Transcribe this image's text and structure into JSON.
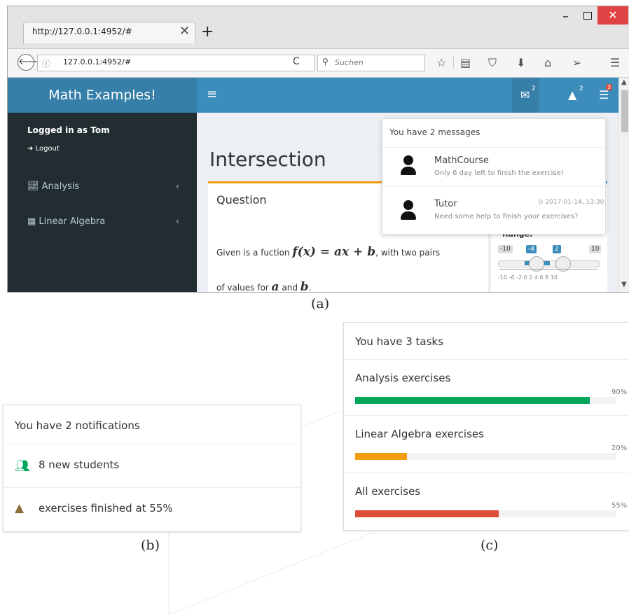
{
  "browser": {
    "tab_title": "http://127.0.0.1:4952/#",
    "tab_close": "✕",
    "new_tab": "+",
    "window_controls": {
      "minimize": "–",
      "close": "✕"
    },
    "back": "🡐",
    "info": "ⓘ",
    "url": "127.0.0.1:4952/#",
    "reload": "C",
    "search_placeholder": "Suchen",
    "toolbar_icons": [
      "star-icon",
      "reader-icon",
      "pocket-icon",
      "download-icon",
      "home-icon",
      "send-icon",
      "menu-icon"
    ]
  },
  "app": {
    "brand": "Math Examples!",
    "hamburger": "≡",
    "nav_badges": {
      "messages": "2",
      "warnings": "2",
      "tasks": "3"
    },
    "sidebar": {
      "user": "Logged in as Tom",
      "logout": "Logout",
      "items": [
        {
          "label": "Analysis",
          "icon": "line-chart-icon"
        },
        {
          "label": "Linear Algebra",
          "icon": "grid-icon"
        }
      ]
    },
    "page_title": "Intersection",
    "question": {
      "title": "Question",
      "line1_pre": "Given is a fuction ",
      "line1_math": "f(x) = ax + b",
      "line1_post": ", with two pairs",
      "line2_pre": "of values for ",
      "line2_math_a": "a",
      "line2_mid": " and ",
      "line2_math_b": "b",
      "line2_post": "."
    },
    "range": {
      "title": "Range:",
      "min": "-10",
      "low": "-4",
      "high": "2",
      "max": "10",
      "tick_labels": "-10  -6   -2 0  2  4  6  8 10"
    },
    "messages": {
      "header": "You have 2 messages",
      "items": [
        {
          "name": "MathCourse",
          "text": "Only 6 day left to finish the exercise!",
          "time": ""
        },
        {
          "name": "Tutor",
          "text": "Need some help to finish your exercises?",
          "time": "⊙ 2017-01-14, 13:30"
        }
      ]
    }
  },
  "captions": {
    "a": "(a)",
    "b": "(b)",
    "c": "(c)"
  },
  "notifications": {
    "header": "You have 2 notifications",
    "items": [
      {
        "text": "8 new students",
        "icon": "users-icon"
      },
      {
        "text": "exercises finished at 55%",
        "icon": "warning-icon"
      }
    ]
  },
  "tasks": {
    "header": "You have 3 tasks",
    "items": [
      {
        "label": "Analysis exercises",
        "pct_label": "90%",
        "progress": 0.9,
        "color": "#00a65a"
      },
      {
        "label": "Linear Algebra exercises",
        "pct_label": "20%",
        "progress": 0.2,
        "color": "#f39c12"
      },
      {
        "label": "All exercises",
        "pct_label": "55%",
        "progress": 0.55,
        "color": "#dd4b39"
      }
    ]
  },
  "colors": {
    "topbar": "#3c8dbc",
    "brand_bg": "#367fa9",
    "sidebar": "#222d32"
  }
}
